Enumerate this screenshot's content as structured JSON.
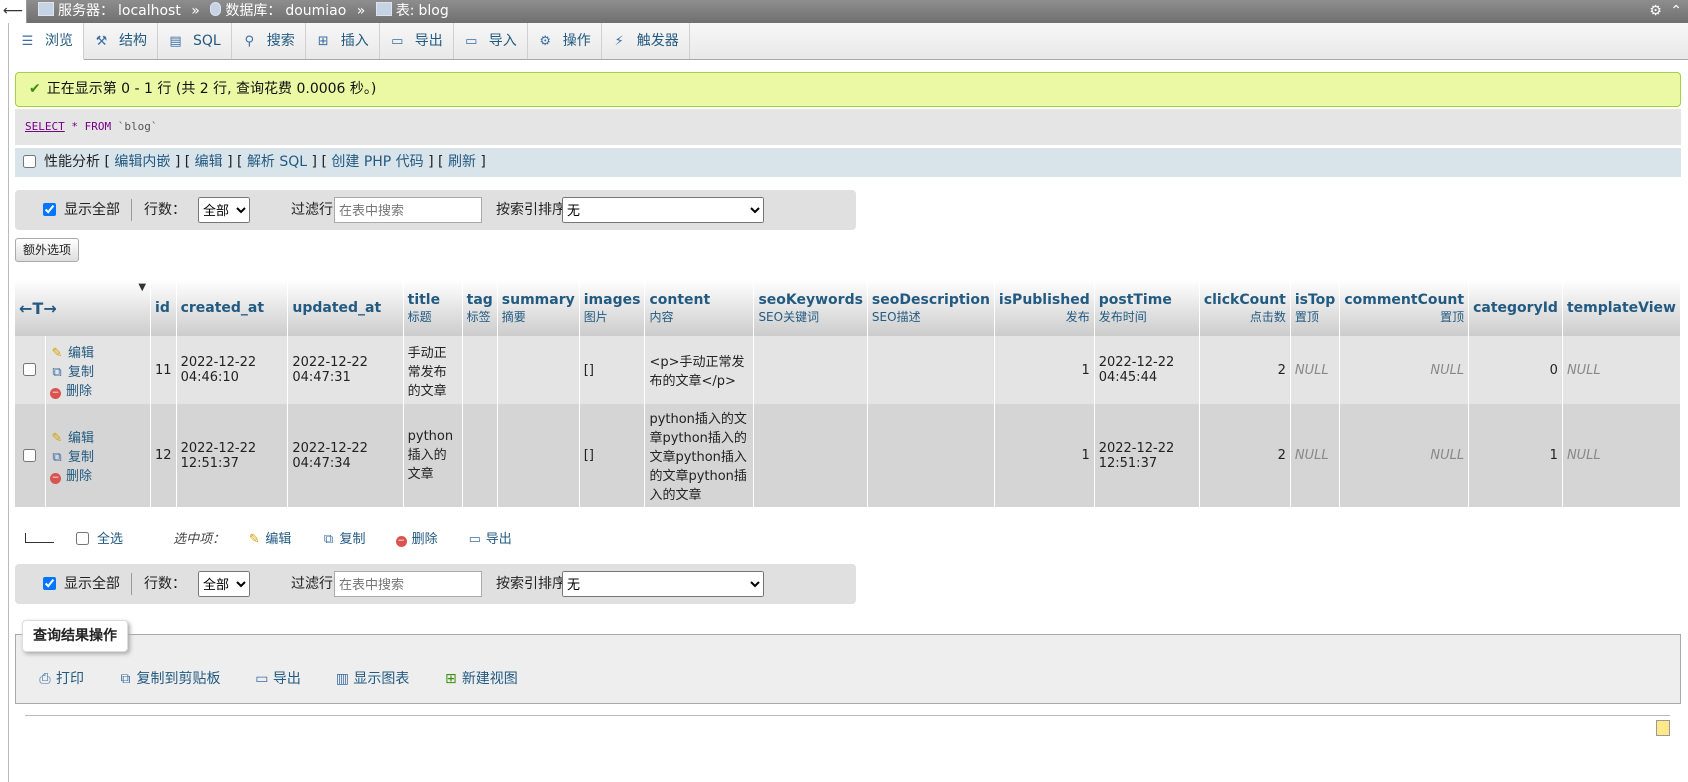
{
  "header": {
    "back_glyph": "⟵",
    "server_label": "服务器：",
    "server_value": "localhost",
    "db_label": "数据库：",
    "db_value": "doumiao",
    "table_label": "表:",
    "table_value": "blog",
    "separator": "»"
  },
  "tabs": [
    {
      "label": "浏览",
      "icon": "browse-icon",
      "glyph": "☰"
    },
    {
      "label": "结构",
      "icon": "structure-icon",
      "glyph": "⚒"
    },
    {
      "label": "SQL",
      "icon": "sql-icon",
      "glyph": "▤"
    },
    {
      "label": "搜索",
      "icon": "search-icon",
      "glyph": "⚲"
    },
    {
      "label": "插入",
      "icon": "insert-icon",
      "glyph": "⊞"
    },
    {
      "label": "导出",
      "icon": "export-icon",
      "glyph": "▭"
    },
    {
      "label": "导入",
      "icon": "import-icon",
      "glyph": "▭"
    },
    {
      "label": "操作",
      "icon": "wrench-icon",
      "glyph": "⚙"
    },
    {
      "label": "触发器",
      "icon": "trigger-icon",
      "glyph": "⚡"
    }
  ],
  "message": "正在显示第 0 - 1 行 (共 2 行, 查询花费 0.0006 秒。)",
  "sql": {
    "select": "SELECT",
    "star": " * ",
    "from": "FROM",
    "table": " `blog`"
  },
  "profile": {
    "label": "性能分析",
    "links": [
      "编辑内嵌",
      "编辑",
      "解析 SQL",
      "创建 PHP 代码",
      "刷新"
    ]
  },
  "nav": {
    "show_all": "显示全部",
    "rows_label": "行数：",
    "rows_value": "全部",
    "filter_label": "过滤行:",
    "filter_placeholder": "在表中搜索",
    "sort_label": "按索引排序：",
    "sort_value": "无"
  },
  "extra_options": "额外选项",
  "table": {
    "arrows": "←T→",
    "columns": [
      {
        "name": "id",
        "sub": ""
      },
      {
        "name": "created_at",
        "sub": ""
      },
      {
        "name": "updated_at",
        "sub": ""
      },
      {
        "name": "title",
        "sub": "标题"
      },
      {
        "name": "tag",
        "sub": "标签"
      },
      {
        "name": "summary",
        "sub": "摘要"
      },
      {
        "name": "images",
        "sub": "图片"
      },
      {
        "name": "content",
        "sub": "内容"
      },
      {
        "name": "seoKeywords",
        "sub": "SEO关键词"
      },
      {
        "name": "seoDescription",
        "sub": "SEO描述"
      },
      {
        "name": "isPublished",
        "sub": "发布"
      },
      {
        "name": "postTime",
        "sub": "发布时间"
      },
      {
        "name": "clickCount",
        "sub": "点击数"
      },
      {
        "name": "isTop",
        "sub": "置顶"
      },
      {
        "name": "commentCount",
        "sub": "置顶"
      },
      {
        "name": "categoryId",
        "sub": ""
      },
      {
        "name": "templateView",
        "sub": ""
      }
    ],
    "actions": {
      "edit": "编辑",
      "copy": "复制",
      "delete": "删除"
    },
    "rows": [
      {
        "id": "11",
        "created_at": "2022-12-22 04:46:10",
        "updated_at": "2022-12-22 04:47:31",
        "title": "手动正常发布的文章",
        "tag": "",
        "summary": "",
        "images": "[]",
        "content": "<p>手动正常发布的文章</p>",
        "seoKeywords": "",
        "seoDescription": "",
        "isPublished": "1",
        "postTime": "2022-12-22 04:45:44",
        "clickCount": "2",
        "isTop": "NULL",
        "commentCount": "NULL",
        "categoryId": "0",
        "templateView": "NULL"
      },
      {
        "id": "12",
        "created_at": "2022-12-22 12:51:37",
        "updated_at": "2022-12-22 04:47:34",
        "title": "python插入的文章",
        "tag": "",
        "summary": "",
        "images": "[]",
        "content": "python插入的文章python插入的文章python插入的文章python插入的文章",
        "seoKeywords": "",
        "seoDescription": "",
        "isPublished": "1",
        "postTime": "2022-12-22 12:51:37",
        "clickCount": "2",
        "isTop": "NULL",
        "commentCount": "NULL",
        "categoryId": "1",
        "templateView": "NULL"
      }
    ]
  },
  "bulk": {
    "select_all": "全选",
    "with_selected": "选中项：",
    "edit": "编辑",
    "copy": "复制",
    "delete": "删除",
    "export": "导出"
  },
  "query_ops": {
    "title": "查询结果操作",
    "links": [
      "打印",
      "复制到剪贴板",
      "导出",
      "显示图表",
      "新建视图"
    ]
  },
  "colors": {
    "success_bg": "#ebf8a4",
    "link": "#235a81",
    "header_bar": "#7f7f7f"
  }
}
